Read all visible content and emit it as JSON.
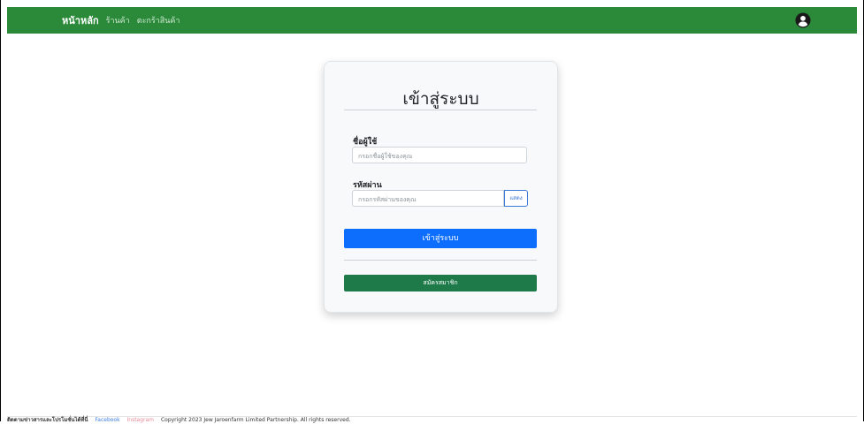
{
  "navbar": {
    "brand": "หน้าหลัก",
    "links": [
      "ร้านค้า",
      "ตะกร้าสินค้า"
    ],
    "user_icon": "user-circle-icon",
    "color": "#2a8a3a"
  },
  "login": {
    "title": "เข้าสู่ระบบ",
    "username_label": "ชื่อผู้ใช้",
    "username_placeholder": "กรอกชื่อผู้ใช้ของคุณ",
    "password_label": "รหัสผ่าน",
    "password_placeholder": "กรอกรหัสผ่านของคุณ",
    "show_label": "แสดง",
    "submit_label": "เข้าสู่ระบบ",
    "register_label": "สมัครสมาชิก"
  },
  "footer": {
    "follow": "ติดตามข่าวสารและโปรโมชั่นได้ที่นี่",
    "facebook": "Facebook",
    "instagram": "Instagram",
    "copyright": "Copyright 2023 Jew Jaroenfarm Limited Partnership. All rights reserved."
  }
}
